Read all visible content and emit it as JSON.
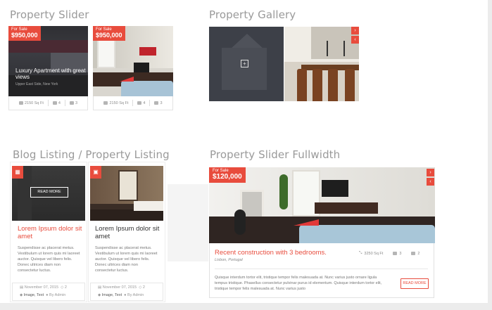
{
  "sections": {
    "property_slider": "Property Slider",
    "property_gallery": "Property Gallery",
    "blog_listing": "Blog Listing / Property Listing",
    "slider_fullwidth": "Property Slider Fullwidth"
  },
  "slider": {
    "slides": [
      {
        "status": "For Sale",
        "price": "$950,000",
        "title": "Luxury Apartment with great views",
        "subtitle": "Upper East Side, New York",
        "area": "2150 Sq Ft",
        "beds": "4",
        "baths": "3"
      },
      {
        "status": "For Sale",
        "price": "$950,000",
        "area": "2150 Sq Ft",
        "beds": "4",
        "baths": "3"
      }
    ]
  },
  "gallery": {
    "plus_icon": "+",
    "next_icon": "›",
    "prev_icon": "‹"
  },
  "blog": {
    "read_more": "READ MORE",
    "posts": [
      {
        "title": "Lorem Ipsum dolor sit amet",
        "excerpt": "Suspendisse ac placerat metus. Vestibulum ut lorem quis mi laoreet auctor. Quisque vel libero felis. Donec ultrices diam non consectetur luctus.",
        "date": "November 07, 2015",
        "comments": "2",
        "tags": "Image, Text",
        "author": "By Admin",
        "icon": "document-icon"
      },
      {
        "title": "Lorem Ipsum dolor sit amet",
        "excerpt": "Suspendisse ac placerat metus. Vestibulum ut lorem quis mi laoreet auctor. Quisque vel libero felis. Donec ultrices diam non consectetur luctus.",
        "date": "November 07, 2015",
        "comments": "2",
        "tags": "Image, Text",
        "author": "By Admin",
        "icon": "film-icon"
      }
    ]
  },
  "fullwidth": {
    "status": "For Sale",
    "price": "$120,000",
    "title": "Recent construction with 3 bedrooms.",
    "location": "Lisbon, Portugal",
    "area": "3250 Sq Ft",
    "beds": "3",
    "baths": "2",
    "description": "Quisque interdum tortor elit, tristique tempor felis malesuada at. Nunc varius justo ornare ligula tempus tristique. Phasellus consectetur pulvinar purus id elementum. Quisque interdum tortor elit, tristique tempor felis malesuada at. Nunc varius justo",
    "button": "READ MORE"
  },
  "colors": {
    "accent": "#e84c3d",
    "title_gray": "#9a9a9a"
  }
}
